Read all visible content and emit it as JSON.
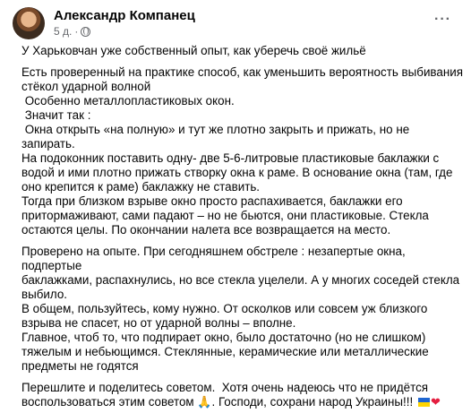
{
  "post": {
    "author": "Александр Компанец",
    "time": "5 д.",
    "dot": "·",
    "more": "···",
    "lines": [
      "У Харьковчан уже собственный опыт, как уберечь своё жильё",
      "",
      "Есть проверенный на практике способ, как уменьшить вероятность выбивания",
      "стёкол ударной волной",
      " Особенно металлопластиковых окон.",
      " Значит так :",
      " Окна открыть «на полную» и тут же плотно закрыть и прижать, но не запирать.",
      "На подоконник поставить одну- две 5-6-литровые пластиковые баклажки с",
      "водой и ими плотно прижать створку окна к раме. В основание окна (там, где",
      "оно крепится к раме) баклажку не ставить.",
      "Тогда при близком взрыве окно просто распахивается, баклажки его",
      "притормаживают, сами падают – но не бьются, они пластиковые. Стекла",
      "остаются целы. По окончании налета все возвращается на место.",
      "",
      "Проверено на опыте. При сегодняшнем обстреле : незапертые окна, подпертые",
      "баклажками, распахнулись, но все стекла уцелели. А у многих соседей стекла",
      "выбило.",
      "В общем, пользуйтесь, кому нужно. От осколков или совсем уж близкого",
      "взрыва не спасет, но от ударной волны – вполне.",
      "Главное, чтоб то, что подпирает окно, было достаточно (но не слишком)",
      "тяжелым и небьющимся. Стеклянные, керамические или металлические",
      "предметы не годятся",
      "",
      "Перешлите и поделитесь советом.  Хотя очень надеюсь что не придётся"
    ],
    "last_line": "воспользоваться этим советом ",
    "pray_emoji": "🙏",
    "last_line_end": ". Господи, сохрани народ Украины!!! ",
    "heart_emoji": "❤"
  }
}
